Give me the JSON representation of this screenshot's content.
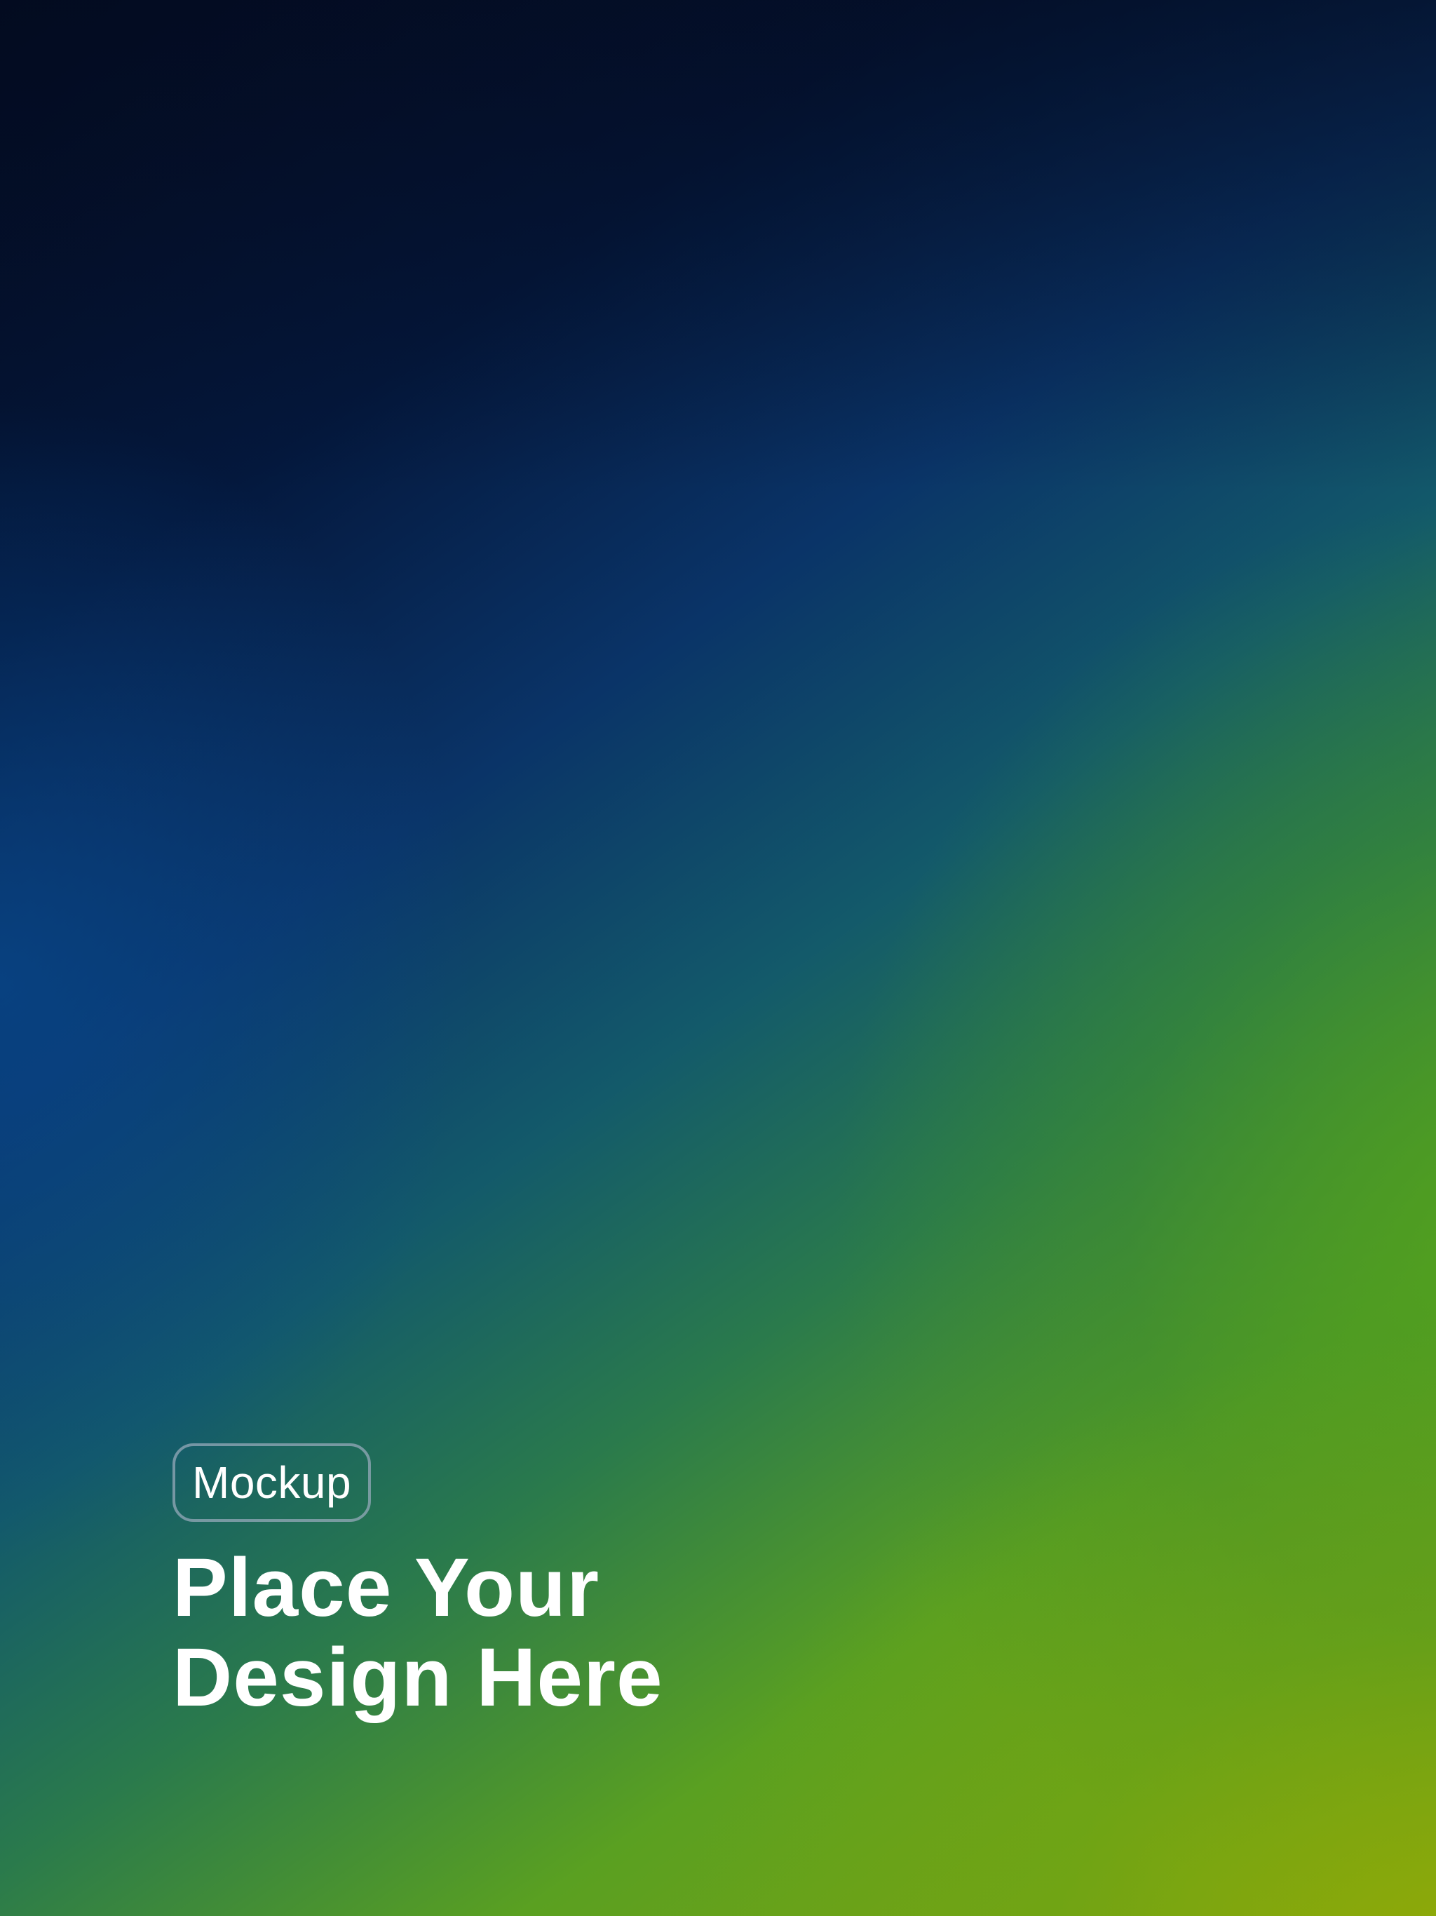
{
  "background": {
    "gradient_colors": [
      "#030d24",
      "#0a3468",
      "#2a7a4c",
      "#5aa021",
      "#86a40c"
    ]
  },
  "badge": {
    "label": "Mockup",
    "border_color": "#96aab9"
  },
  "headline": {
    "line1": "Place Your",
    "line2": "Design Here",
    "color": "#ffffff"
  }
}
